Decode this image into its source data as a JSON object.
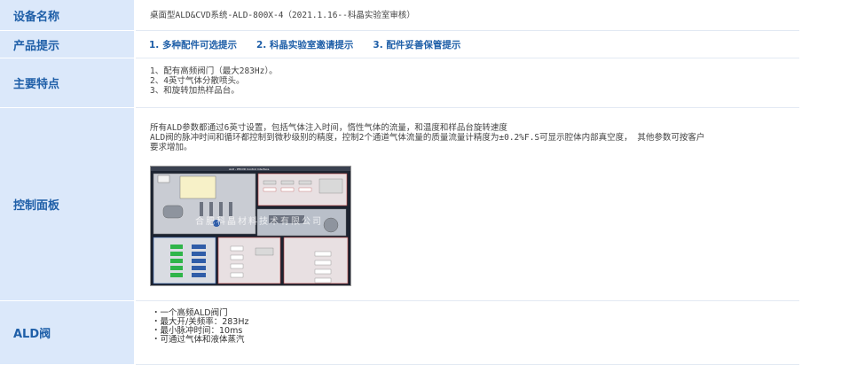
{
  "rows": {
    "device_name": {
      "label": "设备名称",
      "value": "桌面型ALD&CVD系统-ALD-800X-4（2021.1.16--科晶实验室审核）"
    },
    "product_tips": {
      "label": "产品提示",
      "links": [
        "1. 多种配件可选提示",
        "2. 科晶实验室邀请提示",
        "3. 配件妥善保管提示"
      ]
    },
    "features": {
      "label": "主要特点",
      "items": [
        "1、配有高频阀门（最大283Hz）。",
        "2、4英寸气体分散喷头。",
        "3、和旋转加热样品台。"
      ]
    },
    "control_panel": {
      "label": "控制面板",
      "description_1": "所有ALD参数都通过6英寸设置，包括气体注入时间，惰性气体的流量，和温度和样品台旋转速度",
      "description_2": "ALD阀的脉冲时间和循环都控制到微秒级别的精度，控制2个通道气体流量的质量流量计精度为±0.2%F.S可显示腔体内部真空度，  其他参数可按客户",
      "description_3": "要求增加。",
      "panel_title": "ALD - PECVD Control Interface",
      "panel_watermark": "合肥科晶材料技术有限公司"
    },
    "ald_valve": {
      "label": "ALD阀",
      "items": [
        "・一个高频ALD阀门",
        "・最大开/关频率：283Hz",
        "・最小脉冲时间：10ms",
        "・可通过气体和液体蒸汽"
      ]
    }
  },
  "colors": {
    "label_bg": "#dbe8fa",
    "label_text": "#1f5fa8",
    "panel_bg": "#1c2330"
  }
}
